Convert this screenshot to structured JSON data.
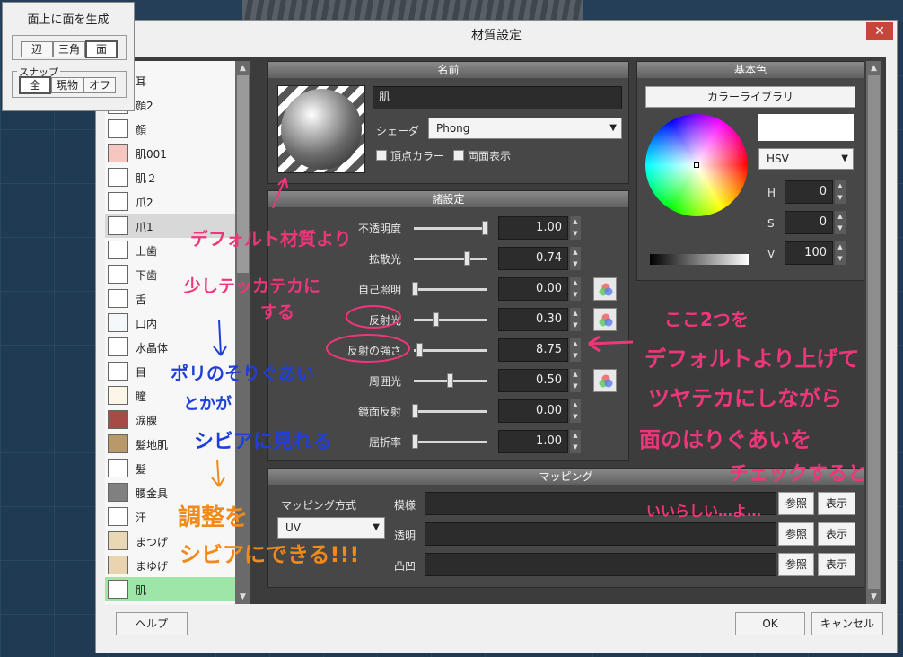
{
  "tool_window": {
    "title": "面上に面を生成",
    "buttons": [
      "辺",
      "三角",
      "面"
    ],
    "snap_label": "スナップ",
    "snap_buttons": [
      "全",
      "現物",
      "オフ"
    ]
  },
  "dialog": {
    "title": "材質設定",
    "close": "✕",
    "help": "ヘルプ",
    "ok": "OK",
    "cancel": "キャンセル"
  },
  "materials": [
    {
      "name": "耳",
      "color": "#ffffff"
    },
    {
      "name": "顔2",
      "color": "#ffffff"
    },
    {
      "name": "顔",
      "color": "#ffffff"
    },
    {
      "name": "肌001",
      "color": "#f6c6c0"
    },
    {
      "name": "肌２",
      "color": "#ffffff"
    },
    {
      "name": "爪2",
      "color": "#ffffff"
    },
    {
      "name": "爪1",
      "color": "#ffffff"
    },
    {
      "name": "上歯",
      "color": "#ffffff"
    },
    {
      "name": "下歯",
      "color": "#ffffff"
    },
    {
      "name": "舌",
      "color": "#ffffff"
    },
    {
      "name": "口内",
      "color": "#f4f8fb"
    },
    {
      "name": "水晶体",
      "color": "#ffffff"
    },
    {
      "name": "目",
      "color": "#ffffff"
    },
    {
      "name": "瞳",
      "color": "#fbf6e8"
    },
    {
      "name": "涙腺",
      "color": "#a84a45"
    },
    {
      "name": "髪地肌",
      "color": "#b9986a"
    },
    {
      "name": "髪",
      "color": "#ffffff"
    },
    {
      "name": "腰金具",
      "color": "#808080"
    },
    {
      "name": "汗",
      "color": "#ffffff"
    },
    {
      "name": "まつげ",
      "color": "#ead8b4"
    },
    {
      "name": "まゆげ",
      "color": "#e8d4ae"
    },
    {
      "name": "肌",
      "color": "#ffffff"
    }
  ],
  "name_panel": {
    "header": "名前",
    "name_value": "肌",
    "shader_label": "シェーダ",
    "shader_value": "Phong",
    "vertex_color": "頂点カラー",
    "double_side": "両面表示"
  },
  "settings": {
    "header": "諸設定",
    "rows": [
      {
        "label": "不透明度",
        "value": "1.00",
        "pos": 1.0
      },
      {
        "label": "拡散光",
        "value": "0.74",
        "pos": 0.74
      },
      {
        "label": "自己照明",
        "value": "0.00",
        "pos": 0.0
      },
      {
        "label": "反射光",
        "value": "0.30",
        "pos": 0.3
      },
      {
        "label": "反射の強さ",
        "value": "8.75",
        "pos": 0.06
      },
      {
        "label": "周囲光",
        "value": "0.50",
        "pos": 0.5
      },
      {
        "label": "鏡面反射",
        "value": "0.00",
        "pos": 0.0
      },
      {
        "label": "屈折率",
        "value": "1.00",
        "pos": 0.0
      }
    ]
  },
  "base_color": {
    "header": "基本色",
    "library": "カラーライブラリ",
    "mode": "HSV",
    "h_label": "H",
    "h": "0",
    "s_label": "S",
    "s": "0",
    "v_label": "V",
    "v": "100"
  },
  "mapping": {
    "header": "マッピング",
    "method_label": "マッピング方式",
    "method_value": "UV",
    "rows": [
      {
        "label": "模様",
        "ref": "参照",
        "show": "表示"
      },
      {
        "label": "透明",
        "ref": "参照",
        "show": "表示"
      },
      {
        "label": "凸凹",
        "ref": "参照",
        "show": "表示"
      }
    ]
  },
  "annotations": {
    "a1": "デフォルト材質より",
    "a2": "少しテッカテカに",
    "a3": "する",
    "a4": "ポリのそりぐあい",
    "a5": "とかが",
    "a6": "シビアに見れる",
    "a7": "調整を",
    "a8": "シビアにできる!!!",
    "a9": "ここ2つを",
    "a10": "デフォルトより上げて",
    "a11": "ツヤテカにしながら",
    "a12": "面のはりぐあいを",
    "a13": "チェックすると",
    "a14": "いいらしい…よ…",
    "arrow_down": "↓"
  }
}
